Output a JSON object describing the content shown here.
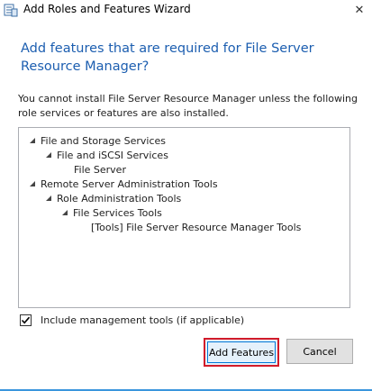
{
  "window": {
    "title": "Add Roles and Features Wizard",
    "close_symbol": "✕"
  },
  "heading": "Add features that are required for File Server Resource Manager?",
  "description": "You cannot install File Server Resource Manager unless the following role services or features are also installed.",
  "tree": [
    {
      "label": "File and Storage Services",
      "level": 0,
      "expanded": true
    },
    {
      "label": "File and iSCSI Services",
      "level": 1,
      "expanded": true
    },
    {
      "label": "File Server",
      "level": 2,
      "expanded": false
    },
    {
      "label": "Remote Server Administration Tools",
      "level": 0,
      "expanded": true
    },
    {
      "label": "Role Administration Tools",
      "level": 1,
      "expanded": true
    },
    {
      "label": "File Services Tools",
      "level": 2,
      "expanded": true
    },
    {
      "label": "[Tools] File Server Resource Manager Tools",
      "level": 3,
      "expanded": false
    }
  ],
  "include_tools": {
    "label": "Include management tools (if applicable)",
    "checked": true
  },
  "buttons": {
    "add_features": "Add Features",
    "cancel": "Cancel"
  },
  "colors": {
    "heading": "#1c5eb0",
    "highlight": "#d21b2a",
    "accent_line": "#3a96dd"
  }
}
